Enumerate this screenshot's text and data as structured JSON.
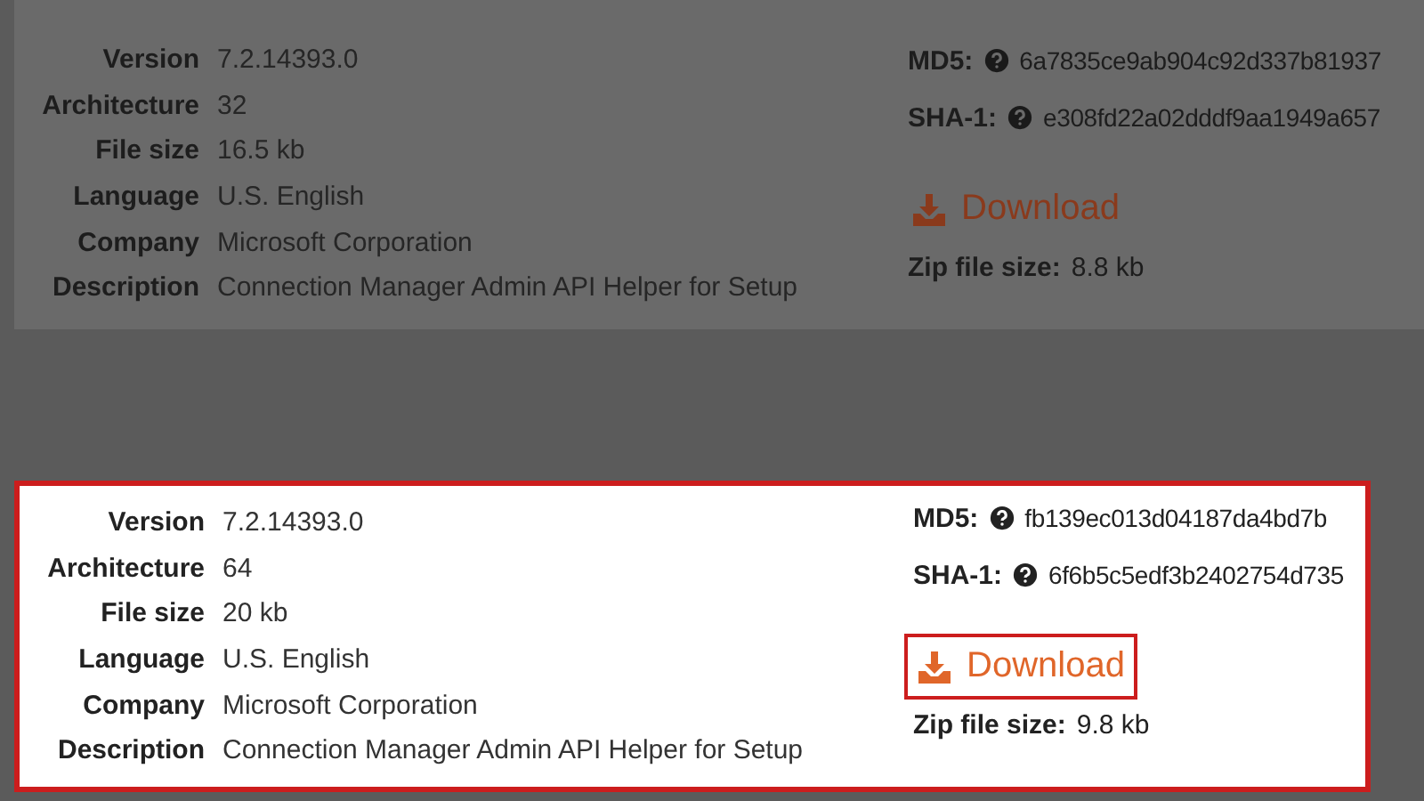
{
  "entries": [
    {
      "dimmed": true,
      "highlighted": false,
      "details": [
        {
          "label": "Version",
          "value": "7.2.14393.0"
        },
        {
          "label": "Architecture",
          "value": "32"
        },
        {
          "label": "File size",
          "value": "16.5 kb"
        },
        {
          "label": "Language",
          "value": "U.S. English"
        },
        {
          "label": "Company",
          "value": "Microsoft Corporation"
        },
        {
          "label": "Description",
          "value": "Connection Manager Admin API Helper for Setup"
        }
      ],
      "md5": {
        "label": "MD5:",
        "value": "6a7835ce9ab904c92d337b81937"
      },
      "sha1": {
        "label": "SHA-1:",
        "value": "e308fd22a02dddf9aa1949a657"
      },
      "download": {
        "label": "Download",
        "highlighted": false
      },
      "zip": {
        "label": "Zip file size:",
        "value": "8.8 kb"
      }
    },
    {
      "dimmed": false,
      "highlighted": true,
      "details": [
        {
          "label": "Version",
          "value": "7.2.14393.0"
        },
        {
          "label": "Architecture",
          "value": "64"
        },
        {
          "label": "File size",
          "value": "20 kb"
        },
        {
          "label": "Language",
          "value": "U.S. English"
        },
        {
          "label": "Company",
          "value": "Microsoft Corporation"
        },
        {
          "label": "Description",
          "value": "Connection Manager Admin API Helper for Setup"
        }
      ],
      "md5": {
        "label": "MD5:",
        "value": "fb139ec013d04187da4bd7b"
      },
      "sha1": {
        "label": "SHA-1:",
        "value": "6f6b5c5edf3b2402754d735"
      },
      "download": {
        "label": "Download",
        "highlighted": true
      },
      "zip": {
        "label": "Zip file size:",
        "value": "9.8 kb"
      }
    }
  ]
}
